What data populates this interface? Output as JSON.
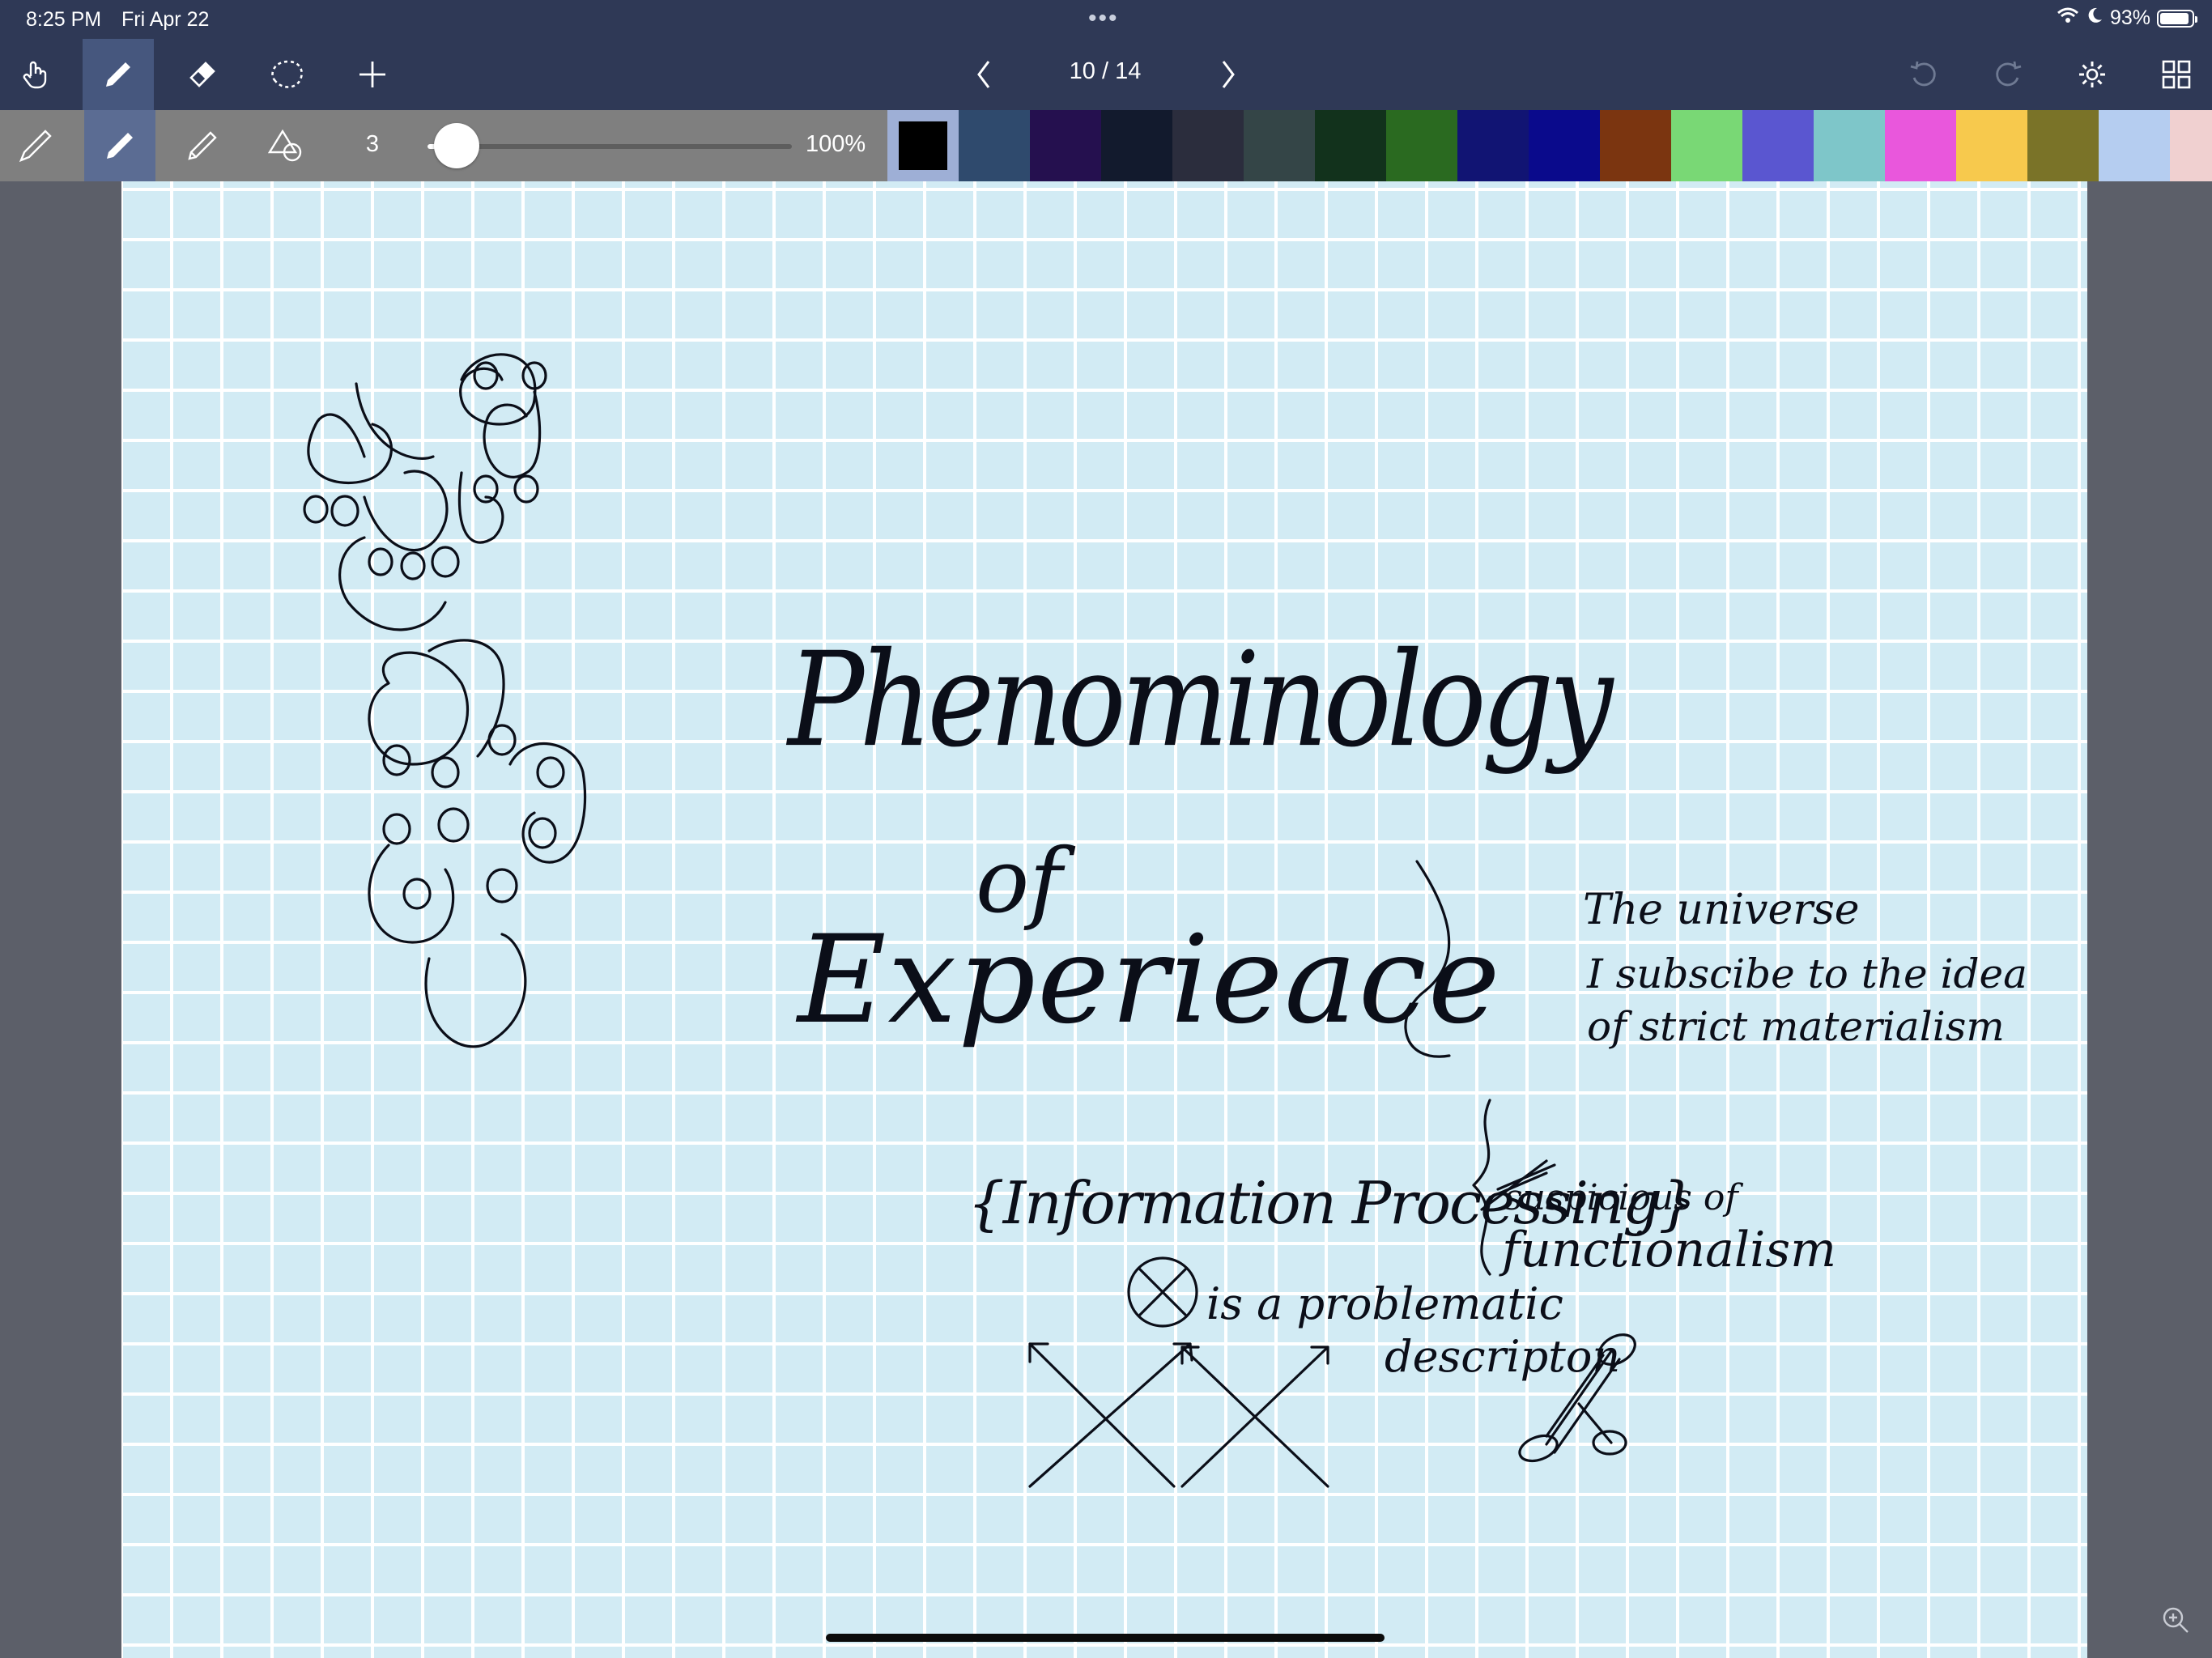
{
  "status": {
    "time": "8:25 PM",
    "date": "Fri Apr 22",
    "more": "•••",
    "battery_text": "93%",
    "battery_level": 0.93
  },
  "toolbar": {
    "page_indicator": "10 / 14",
    "tools": [
      "hand-icon",
      "pen-icon",
      "eraser-icon",
      "lasso-icon",
      "add-icon"
    ],
    "active_tool": "pen-icon",
    "right_tools": [
      "undo-icon",
      "redo-icon",
      "settings-icon",
      "grid-view-icon"
    ]
  },
  "penbar": {
    "size_value": "3",
    "zoom_value": "100%",
    "slider_level": 0.08,
    "pen_types": [
      "fountain-pen-icon",
      "ballpoint-pen-icon",
      "pencil-icon",
      "shapes-icon"
    ],
    "active_pen": "ballpoint-pen-icon"
  },
  "palette": [
    "#000000",
    "#2f4a6d",
    "#25104f",
    "#121a2d",
    "#2b2d3d",
    "#344547",
    "#12321c",
    "#2a6a20",
    "#111473",
    "#0a0a8c",
    "#7b3510",
    "#79d875",
    "#5a56d0",
    "#7ec6c9",
    "#e957dc",
    "#f7c94d",
    "#7a7328",
    "#b5cdf0",
    "#f0d0d0"
  ],
  "selected_color": "#000000",
  "note": {
    "title_line1": "Phenominology",
    "title_line2": "of",
    "title_line3": "Experieace",
    "universe": "The universe",
    "subscribe_line1": "I subscibe to the idea",
    "subscribe_line2": "of strict materialism",
    "info_processing": "{Information Processing}",
    "problematic": "is a problematic",
    "description": "descripton",
    "suspicious": "suspicious of",
    "functionalism": "functionalism"
  }
}
